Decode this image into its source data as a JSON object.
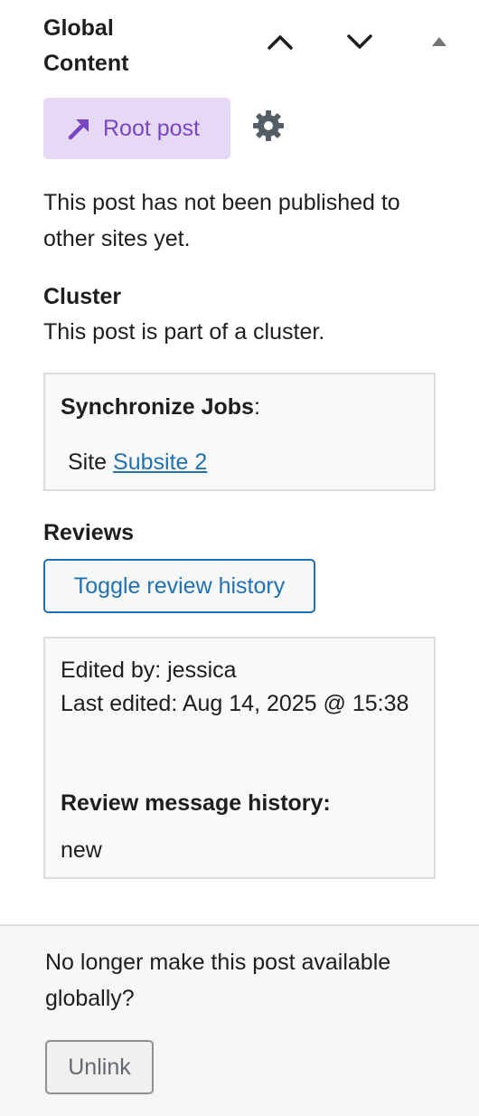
{
  "panel": {
    "title": "Global Content",
    "move_up_icon": "chevron-up-icon",
    "move_down_icon": "chevron-down-icon",
    "toggle_icon": "caret-up-icon"
  },
  "root_post": {
    "label": "Root post",
    "icon": "arrow-up-right-icon",
    "settings_icon": "gear-icon"
  },
  "status_text": "This post has not been published to other sites yet.",
  "cluster": {
    "heading": "Cluster",
    "text": "This post is part of a cluster."
  },
  "sync_jobs": {
    "title": "Synchronize Jobs",
    "title_suffix": ":",
    "site_prefix": "Site",
    "site_link": "Subsite 2"
  },
  "reviews": {
    "heading": "Reviews",
    "toggle_label": "Toggle review history",
    "edited_by": "Edited by: jessica",
    "last_edited": "Last edited: Aug 14, 2025 @ 15:38",
    "history_title": "Review message history:",
    "history_message": "new"
  },
  "footer": {
    "question": "No longer make this post available globally?",
    "unlink_label": "Unlink"
  },
  "colors": {
    "accent_purple": "#7a45c4",
    "root_post_bg": "#e6d9f5",
    "link_blue": "#2271b1",
    "border_gray": "#dcdcde"
  }
}
